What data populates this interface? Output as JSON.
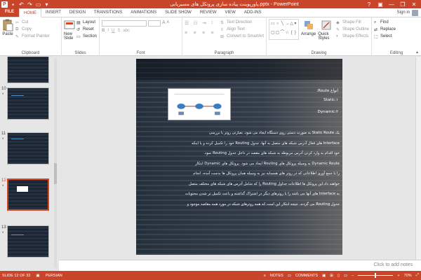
{
  "window": {
    "title": "پاورپوینت پیاده سازی پروتکل های مسیریابی.pptx - PowerPoint",
    "help": "?",
    "minimize": "—",
    "restore": "❐",
    "close": "✕"
  },
  "tabs": [
    "FILE",
    "HOME",
    "INSERT",
    "DESIGN",
    "TRANSITIONS",
    "ANIMATIONS",
    "SLIDE SHOW",
    "REVIEW",
    "VIEW",
    "ADD-INS"
  ],
  "active_tab": "HOME",
  "signin": "Sign in",
  "ribbon": {
    "clipboard": {
      "paste": "Paste",
      "cut": "Cut",
      "copy": "Copy",
      "format_painter": "Format Painter",
      "label": "Clipboard"
    },
    "slides": {
      "new_slide": "New Slide",
      "layout": "Layout",
      "reset": "Reset",
      "section": "Section",
      "label": "Slides"
    },
    "font": {
      "label": "Font",
      "bold": "B",
      "italic": "I",
      "underline": "U",
      "strike": "S",
      "shadow": "abc",
      "size_up": "A",
      "size_down": "A"
    },
    "paragraph": {
      "text_direction": "Text Direction",
      "align_text": "Align Text",
      "smartart": "Convert to SmartArt",
      "label": "Paragraph"
    },
    "drawing": {
      "arrange": "Arrange",
      "quick_styles": "Quick Styles",
      "shape_fill": "Shape Fill",
      "shape_outline": "Shape Outline",
      "shape_effects": "Shape Effects",
      "label": "Drawing"
    },
    "editing": {
      "find": "Find",
      "replace": "Replace",
      "select": "Select",
      "label": "Editing"
    }
  },
  "thumbnails": [
    {
      "number": "",
      "star": ""
    },
    {
      "number": "10",
      "star": "*"
    },
    {
      "number": "11",
      "star": "*"
    },
    {
      "number": "12",
      "star": "*",
      "selected": true
    },
    {
      "number": "13",
      "star": "*"
    }
  ],
  "slide": {
    "heading1": "انواع Route:",
    "heading2": "Static:۱",
    "heading3": "Dynamic:۲",
    "paragraphs": [
      "یک Static Route به صورت دستی روی دستگاه ایجاد می شود. بعبارتی روتر با بررسی",
      "Interface های فعال آدرس شبکه های متصل به آنها، جدول Routing خود را تکمیل کرده و یا اینکه",
      "خود اقدام به وارد کردن آدرس مربوطه به شبکه های مقصد در داخل جدول Routing نمود.",
      "Dynamic Route به وسیله پروتکل های Routing ایجاد می شود. پروتکل های Dynamic ابتکار",
      "را با جمع آوری اطلاعاتی که در روتر های همسایه نیز به وسیله همان پروتکل ها بدست آمده، انجام",
      "خواهند داد.این پروتکل ها اطلاعات جداول Routing را که شامل آدرس های شبکه های مختلف متصل",
      "به Interface های آنها می باشد را با روترهای دیگر در اشتراک گذاشته و باعث تکمیل تر شدن محتویات",
      "جدول Routing می گردند. نتیجه ابتکار این است که همه روترهای شبکه در مورد همه مقاصد موجود و"
    ]
  },
  "notes_placeholder": "Click to add notes",
  "status": {
    "slide_info": "SLIDE 12 OF 33",
    "language": "PERSIAN",
    "notes": "NOTES",
    "comments": "COMMENTS",
    "zoom": "70%"
  }
}
